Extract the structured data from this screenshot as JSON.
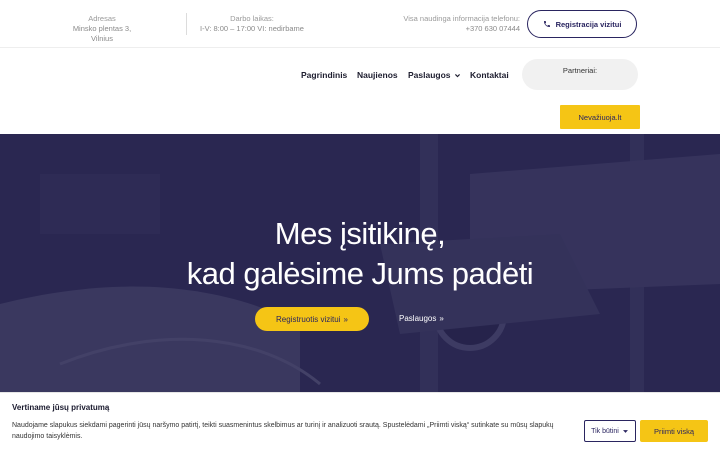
{
  "topbar": {
    "address_label": "Adresas",
    "address_value": "Minsko plentas 3, Vilnius",
    "hours_label": "Darbo laikas:",
    "hours_value": "I-V: 8:00 – 17:00 VI: nedirbame",
    "phone_label": "Visa naudinga informacija telefonu:",
    "phone_value": "+370 630 07444",
    "register_button": "Registracija vizitui",
    "register_icon": "phone-icon"
  },
  "nav": {
    "items": [
      {
        "label": "Pagrindinis"
      },
      {
        "label": "Naujienos"
      },
      {
        "label": "Paslaugos",
        "has_dropdown": true
      },
      {
        "label": "Kontaktai"
      }
    ],
    "partners_label": "Partneriai:",
    "partner_button": "Nevažiuoja.lt"
  },
  "hero": {
    "title_line1": "Mes įsitikinę,",
    "title_line2": "kad galėsime Jums padėti",
    "primary_button": "Registruotis vizitui",
    "secondary_link": "Paslaugos",
    "arrow_glyph": "»"
  },
  "cookie": {
    "title": "Vertiname jūsų privatumą",
    "text": "Naudojame slapukus siekdami pagerinti jūsų naršymo patirtį, teikti suasmenintus skelbimus ar turinį ir analizuoti srautą. Spustelėdami „Priimti viską“ sutinkate su mūsų slapukų naudojimo taisyklėmis.",
    "necessary_button": "Tik būtini",
    "accept_button": "Priimti viską"
  },
  "colors": {
    "brand_navy": "#2a2560",
    "hero_bg": "#2a2751",
    "accent_yellow": "#f5c515"
  }
}
